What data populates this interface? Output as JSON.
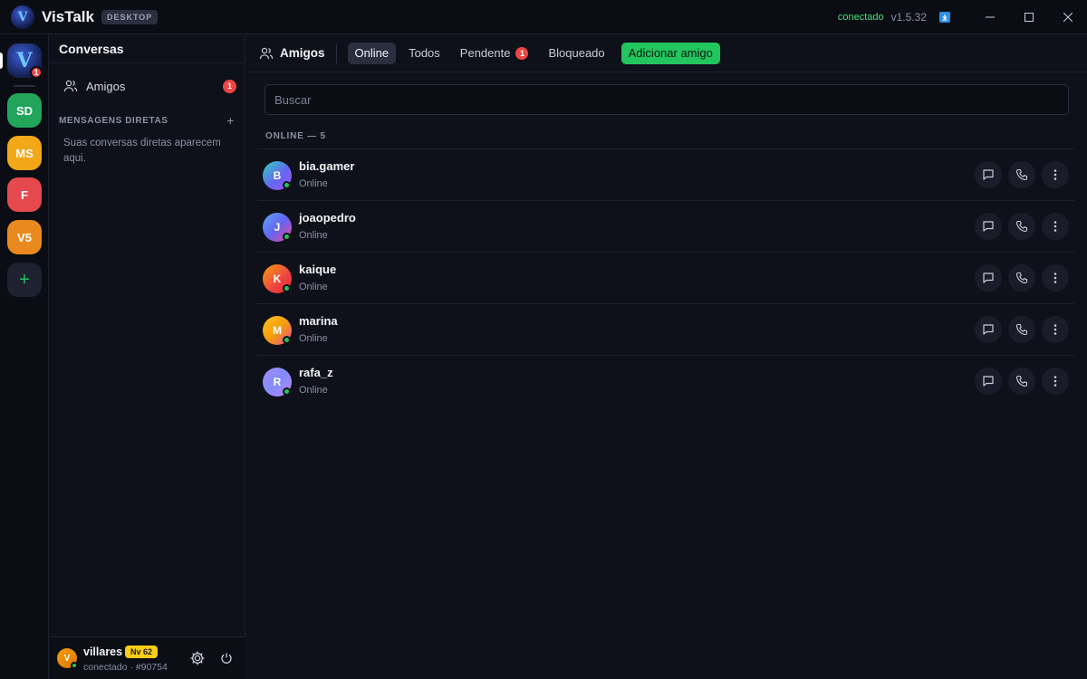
{
  "app": {
    "name": "VisTalk",
    "badge": "DESKTOP",
    "logo_letter": "V",
    "connection_status": "conectado",
    "version": "v1.5.32"
  },
  "rail": {
    "home_badge": "1",
    "servers": [
      {
        "label": "SD",
        "color": "#22a55b"
      },
      {
        "label": "MS",
        "color": "#f2a718"
      },
      {
        "label": "F",
        "color": "#e5484d"
      },
      {
        "label": "V5",
        "color": "#ea8a1e"
      }
    ],
    "add_label": "+"
  },
  "sidebar": {
    "title": "Conversas",
    "friends_item": {
      "label": "Amigos",
      "count": "1"
    },
    "dm_header": "MENSAGENS DIRETAS",
    "dm_add": "+",
    "dm_empty": "Suas conversas diretas aparecem aqui."
  },
  "user": {
    "initial": "V",
    "name": "villares",
    "level": "Nv 62",
    "status": "conectado · #90754"
  },
  "main": {
    "title": "Amigos",
    "tabs": [
      {
        "label": "Online",
        "active": true
      },
      {
        "label": "Todos"
      },
      {
        "label": "Pendente",
        "badge": "1"
      },
      {
        "label": "Bloqueado"
      }
    ],
    "add_friend_label": "Adicionar amigo",
    "search_placeholder": "Buscar",
    "section_label": "ONLINE — 5",
    "friends": [
      {
        "initial": "B",
        "name": "bia.gamer",
        "status": "Online",
        "gradient": "linear-gradient(135deg,#2dd4bf,#6366f1 55%,#a855f7)"
      },
      {
        "initial": "J",
        "name": "joaopedro",
        "status": "Online",
        "gradient": "linear-gradient(135deg,#60a5fa,#6366f1 50%,#ec4899)"
      },
      {
        "initial": "K",
        "name": "kaique",
        "status": "Online",
        "gradient": "linear-gradient(135deg,#f59e0b,#ef4444 60%,#dc2626)"
      },
      {
        "initial": "M",
        "name": "marina",
        "status": "Online",
        "gradient": "linear-gradient(135deg,#fbbf24,#f59e0b 50%,#ec4899)"
      },
      {
        "initial": "R",
        "name": "rafa_z",
        "status": "Online",
        "gradient": "linear-gradient(135deg,#a78bfa,#818cf8 50%,#c084fc)"
      }
    ]
  }
}
